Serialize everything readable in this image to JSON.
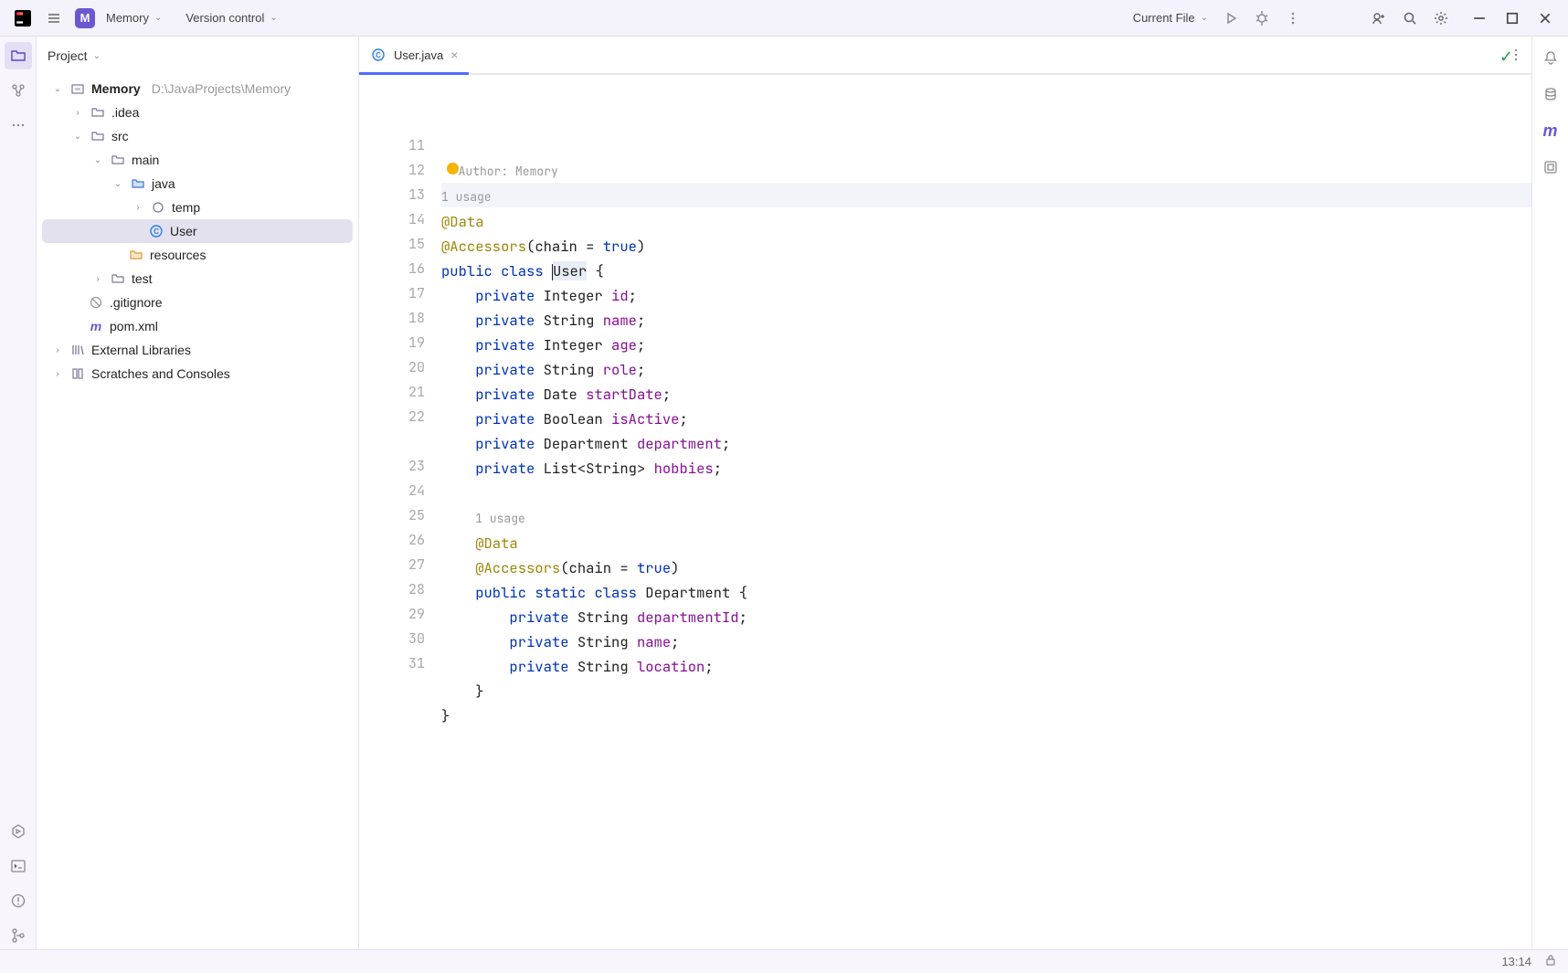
{
  "topbar": {
    "project_abbr": "M",
    "project_name": "Memory",
    "vcs_label": "Version control",
    "run_config": "Current File"
  },
  "sidebar": {
    "title": "Project",
    "root_name": "Memory",
    "root_path": "D:\\JavaProjects\\Memory",
    "idea": ".idea",
    "src": "src",
    "main": "main",
    "java": "java",
    "temp": "temp",
    "user": "User",
    "resources": "resources",
    "test": "test",
    "gitignore": ".gitignore",
    "pom": "pom.xml",
    "ext_lib": "External Libraries",
    "scratches": "Scratches and Consoles"
  },
  "tab": {
    "filename": "User.java"
  },
  "editor": {
    "author_line": "Author: Memory",
    "usage1": "1 usage",
    "usage2": "1 usage",
    "lines": {
      "11": {
        "ann": "@Data"
      },
      "12": {
        "ann": "@Accessors",
        "op": "(",
        "arg": "chain = ",
        "lit": "true",
        "cp": ")"
      },
      "13": {
        "kw1": "public",
        "kw2": "class",
        "name": "User",
        "ob": " {"
      },
      "14": {
        "kw": "private",
        "type": "Integer",
        "field": "id"
      },
      "15": {
        "kw": "private",
        "type": "String",
        "field": "name"
      },
      "16": {
        "kw": "private",
        "type": "Integer",
        "field": "age"
      },
      "17": {
        "kw": "private",
        "type": "String",
        "field": "role"
      },
      "18": {
        "kw": "private",
        "type": "Date",
        "field": "startDate"
      },
      "19": {
        "kw": "private",
        "type": "Boolean",
        "field": "isActive"
      },
      "20": {
        "kw": "private",
        "type": "Department",
        "field": "department"
      },
      "21": {
        "kw": "private",
        "type1": "List",
        "lt": "<",
        "type2": "String",
        "gt": ">",
        "field": "hobbies"
      },
      "23": {
        "ann": "@Data"
      },
      "24": {
        "ann": "@Accessors",
        "op": "(",
        "arg": "chain = ",
        "lit": "true",
        "cp": ")"
      },
      "25": {
        "kw1": "public",
        "kw2": "static",
        "kw3": "class",
        "name": "Department",
        "ob": " {"
      },
      "26": {
        "kw": "private",
        "type": "String",
        "field": "departmentId"
      },
      "27": {
        "kw": "private",
        "type": "String",
        "field": "name"
      },
      "28": {
        "kw": "private",
        "type": "String",
        "field": "location"
      },
      "29": {
        "cb": "}"
      },
      "30": {
        "cb": "}"
      }
    },
    "line_numbers": [
      "11",
      "12",
      "13",
      "14",
      "15",
      "16",
      "17",
      "18",
      "19",
      "20",
      "21",
      "22",
      "23",
      "24",
      "25",
      "26",
      "27",
      "28",
      "29",
      "30",
      "31"
    ]
  },
  "status": {
    "time": "13:14"
  }
}
